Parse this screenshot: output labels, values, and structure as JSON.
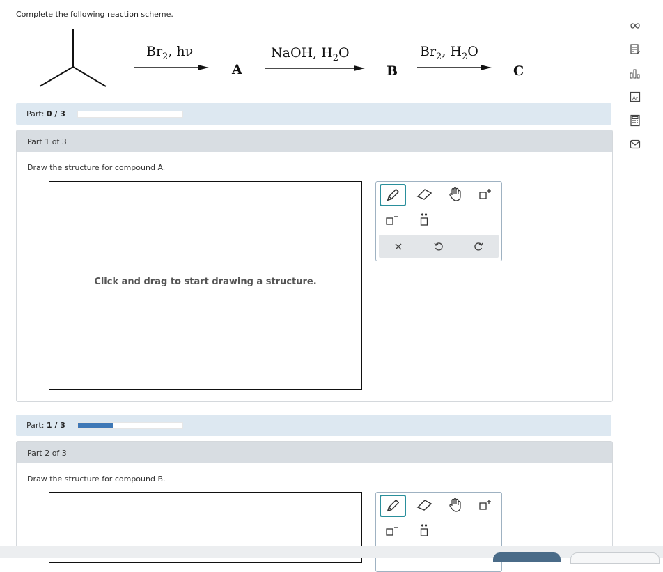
{
  "intro": "Complete the following reaction scheme.",
  "scheme": {
    "step1": {
      "reagent_main": "Br",
      "reagent_sub": "2",
      "reagent_rest": ", hν",
      "product": "A"
    },
    "step2": {
      "reagent_main": "NaOH, H",
      "reagent_sub": "2",
      "reagent_rest": "O",
      "product": "B"
    },
    "step3": {
      "reagent_main": "Br",
      "reagent_sub": "2",
      "reagent_mid": ", H",
      "reagent_sub2": "2",
      "reagent_rest": "O",
      "product": "C"
    }
  },
  "parts": [
    {
      "progress_label": "Part:",
      "progress_value": "0 / 3",
      "progress_fraction": 0,
      "header": "Part 1 of 3",
      "question": "Draw the structure for compound A.",
      "canvas_hint": "Click and drag to start drawing a structure."
    },
    {
      "progress_label": "Part:",
      "progress_value": "1 / 3",
      "progress_fraction": 0.333,
      "header": "Part 2 of 3",
      "question": "Draw the structure for compound B."
    }
  ],
  "tools": [
    "pencil-icon",
    "eraser-icon",
    "hand-icon",
    "add-atom-icon",
    "negative-charge-icon",
    "lone-pair-icon",
    "clear-icon",
    "undo-icon",
    "redo-icon"
  ],
  "sidebar": [
    "infinity-icon",
    "clipboard-icon",
    "chart-icon",
    "periodic-table-icon",
    "calculator-icon",
    "mail-icon"
  ],
  "colors": {
    "accent": "#2a8f9c",
    "progress": "#3f78b6",
    "partbar": "#dde8f1",
    "partheader": "#d8dde2"
  }
}
